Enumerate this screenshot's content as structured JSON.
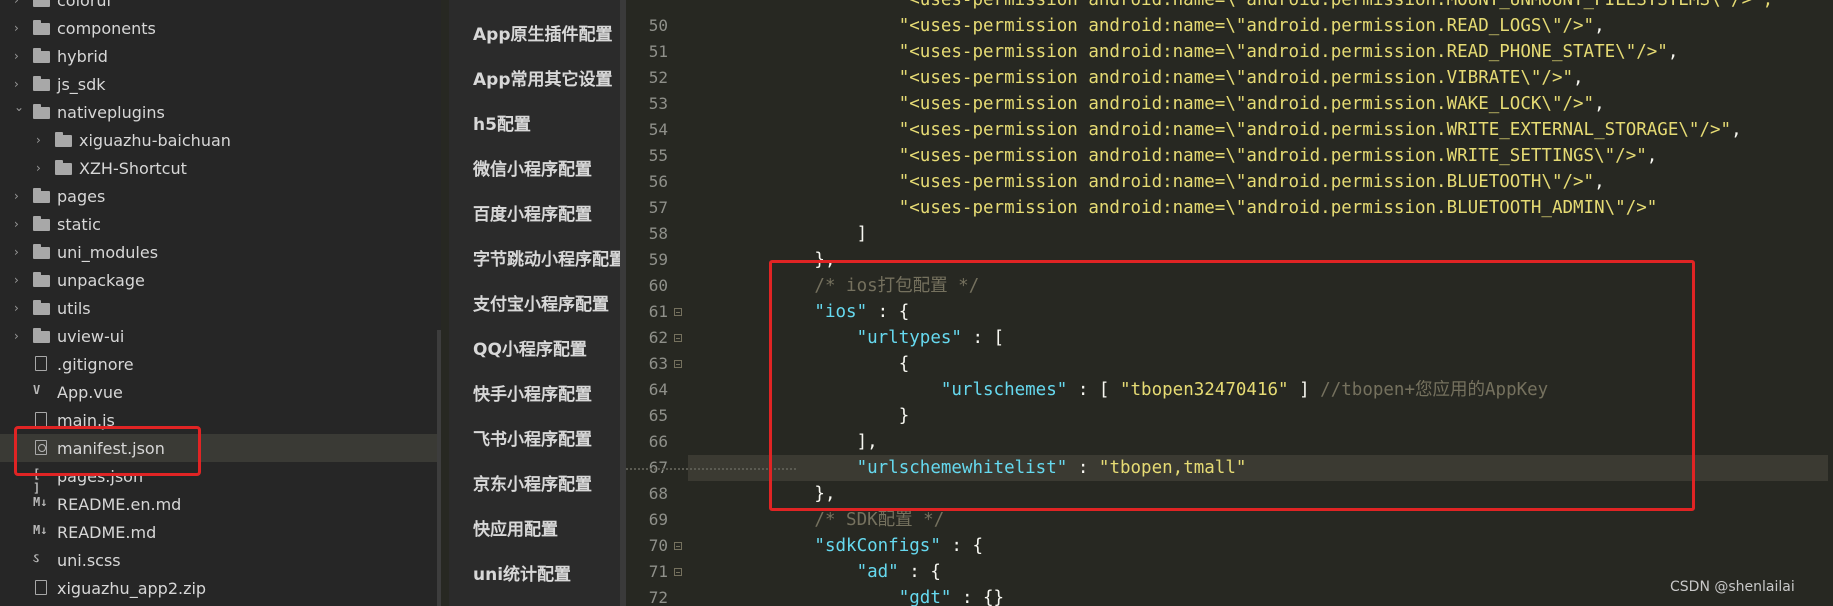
{
  "file_tree": {
    "items": [
      {
        "label": "colorui",
        "type": "folder",
        "icon": "folder-icon",
        "expanded": false
      },
      {
        "label": "components",
        "type": "folder",
        "icon": "folder-icon",
        "expanded": false
      },
      {
        "label": "hybrid",
        "type": "folder",
        "icon": "folder-icon",
        "expanded": false
      },
      {
        "label": "js_sdk",
        "type": "folder",
        "icon": "folder-icon",
        "expanded": false
      },
      {
        "label": "nativeplugins",
        "type": "folder",
        "icon": "folder-icon",
        "expanded": true
      },
      {
        "label": "xiguazhu-baichuan",
        "type": "folder",
        "icon": "folder-icon",
        "expanded": false
      },
      {
        "label": "XZH-Shortcut",
        "type": "folder",
        "icon": "folder-icon",
        "expanded": false
      },
      {
        "label": "pages",
        "type": "folder",
        "icon": "folder-icon",
        "expanded": false
      },
      {
        "label": "static",
        "type": "folder",
        "icon": "folder-icon",
        "expanded": false
      },
      {
        "label": "uni_modules",
        "type": "folder",
        "icon": "folder-icon",
        "expanded": false
      },
      {
        "label": "unpackage",
        "type": "folder",
        "icon": "folder-icon",
        "expanded": false
      },
      {
        "label": "utils",
        "type": "folder",
        "icon": "folder-icon",
        "expanded": false
      },
      {
        "label": "uview-ui",
        "type": "folder",
        "icon": "folder-icon",
        "expanded": false
      },
      {
        "label": ".gitignore",
        "type": "file",
        "icon": "file-icon"
      },
      {
        "label": "App.vue",
        "type": "file",
        "icon": "vue-file-icon",
        "glyph": "V"
      },
      {
        "label": "main.js",
        "type": "file",
        "icon": "js-file-icon"
      },
      {
        "label": "manifest.json",
        "type": "file",
        "icon": "settings-file-icon",
        "selected": true
      },
      {
        "label": "pages.json",
        "type": "file",
        "icon": "json-file-icon",
        "glyph": "[ ]"
      },
      {
        "label": "README.en.md",
        "type": "file",
        "icon": "markdown-icon",
        "glyph": "M↓"
      },
      {
        "label": "README.md",
        "type": "file",
        "icon": "markdown-icon",
        "glyph": "M↓"
      },
      {
        "label": "uni.scss",
        "type": "file",
        "icon": "scss-file-icon",
        "glyph": "ઽ"
      },
      {
        "label": "xiguazhu_app2.zip",
        "type": "file",
        "icon": "file-icon"
      }
    ]
  },
  "settings_nav": {
    "items": [
      "App原生插件配置",
      "App常用其它设置",
      "h5配置",
      "微信小程序配置",
      "百度小程序配置",
      "字节跳动小程序配置",
      "支付宝小程序配置",
      "QQ小程序配置",
      "快手小程序配置",
      "飞书小程序配置",
      "京东小程序配置",
      "快应用配置",
      "uni统计配置"
    ]
  },
  "editor": {
    "current_line": 67,
    "lines": [
      {
        "num": "",
        "fold": false,
        "segs": [
          [
            "s",
            "                    \"<uses-permission android:name=\\\"android.permission.MOUNT_UNMOUNT_FILESYSTEMS\\\"/>\","
          ]
        ]
      },
      {
        "num": "50",
        "fold": false,
        "segs": [
          [
            "s",
            "                    \"<uses-permission android:name=\\\"android.permission.READ_LOGS\\\"/>\""
          ],
          [
            "p",
            ","
          ]
        ]
      },
      {
        "num": "51",
        "fold": false,
        "segs": [
          [
            "s",
            "                    \"<uses-permission android:name=\\\"android.permission.READ_PHONE_STATE\\\"/>\""
          ],
          [
            "p",
            ","
          ]
        ]
      },
      {
        "num": "52",
        "fold": false,
        "segs": [
          [
            "s",
            "                    \"<uses-permission android:name=\\\"android.permission.VIBRATE\\\"/>\""
          ],
          [
            "p",
            ","
          ]
        ]
      },
      {
        "num": "53",
        "fold": false,
        "segs": [
          [
            "s",
            "                    \"<uses-permission android:name=\\\"android.permission.WAKE_LOCK\\\"/>\""
          ],
          [
            "p",
            ","
          ]
        ]
      },
      {
        "num": "54",
        "fold": false,
        "segs": [
          [
            "s",
            "                    \"<uses-permission android:name=\\\"android.permission.WRITE_EXTERNAL_STORAGE\\\"/>\""
          ],
          [
            "p",
            ","
          ]
        ]
      },
      {
        "num": "55",
        "fold": false,
        "segs": [
          [
            "s",
            "                    \"<uses-permission android:name=\\\"android.permission.WRITE_SETTINGS\\\"/>\""
          ],
          [
            "p",
            ","
          ]
        ]
      },
      {
        "num": "56",
        "fold": false,
        "segs": [
          [
            "s",
            "                    \"<uses-permission android:name=\\\"android.permission.BLUETOOTH\\\"/>\""
          ],
          [
            "p",
            ","
          ]
        ]
      },
      {
        "num": "57",
        "fold": false,
        "segs": [
          [
            "s",
            "                    \"<uses-permission android:name=\\\"android.permission.BLUETOOTH_ADMIN\\\"/>\""
          ]
        ]
      },
      {
        "num": "58",
        "fold": false,
        "segs": [
          [
            "p",
            "                ]"
          ]
        ]
      },
      {
        "num": "59",
        "fold": false,
        "segs": [
          [
            "p",
            "            },"
          ]
        ]
      },
      {
        "num": "60",
        "fold": false,
        "segs": [
          [
            "c",
            "            /* ios打包配置 */"
          ]
        ]
      },
      {
        "num": "61",
        "fold": true,
        "segs": [
          [
            "k",
            "            \"ios\""
          ],
          [
            "p",
            " : {"
          ]
        ]
      },
      {
        "num": "62",
        "fold": true,
        "segs": [
          [
            "k",
            "                \"urltypes\""
          ],
          [
            "p",
            " : ["
          ]
        ]
      },
      {
        "num": "63",
        "fold": true,
        "segs": [
          [
            "p",
            "                    {"
          ]
        ]
      },
      {
        "num": "64",
        "fold": false,
        "segs": [
          [
            "k",
            "                        \"urlschemes\""
          ],
          [
            "p",
            " : [ "
          ],
          [
            "s",
            "\"tbopen32470416\""
          ],
          [
            "p",
            " ] "
          ],
          [
            "c",
            "//tbopen+您应用的AppKey"
          ]
        ]
      },
      {
        "num": "65",
        "fold": false,
        "segs": [
          [
            "p",
            "                    }"
          ]
        ]
      },
      {
        "num": "66",
        "fold": false,
        "segs": [
          [
            "p",
            "                ],"
          ]
        ]
      },
      {
        "num": "67",
        "fold": false,
        "segs": [
          [
            "k",
            "                \"urlschemewhitelist\""
          ],
          [
            "p",
            " : "
          ],
          [
            "s",
            "\"tbopen,tmall\""
          ]
        ]
      },
      {
        "num": "68",
        "fold": false,
        "segs": [
          [
            "p",
            "            },"
          ]
        ]
      },
      {
        "num": "69",
        "fold": false,
        "segs": [
          [
            "c",
            "            /* SDK配置 */"
          ]
        ]
      },
      {
        "num": "70",
        "fold": true,
        "segs": [
          [
            "k",
            "            \"sdkConfigs\""
          ],
          [
            "p",
            " : {"
          ]
        ]
      },
      {
        "num": "71",
        "fold": true,
        "segs": [
          [
            "k",
            "                \"ad\""
          ],
          [
            "p",
            " : {"
          ]
        ]
      },
      {
        "num": "72",
        "fold": false,
        "segs": [
          [
            "k",
            "                    \"gdt\""
          ],
          [
            "p",
            " : {}"
          ]
        ]
      }
    ]
  },
  "watermark": "CSDN @shenlailai",
  "colors": {
    "background": "#272822",
    "tree_bg": "#262626",
    "nav_bg": "#2b2b2b",
    "string": "#e6db74",
    "key": "#66d9ef",
    "comment": "#75715e",
    "annotation_red": "#e02424"
  }
}
